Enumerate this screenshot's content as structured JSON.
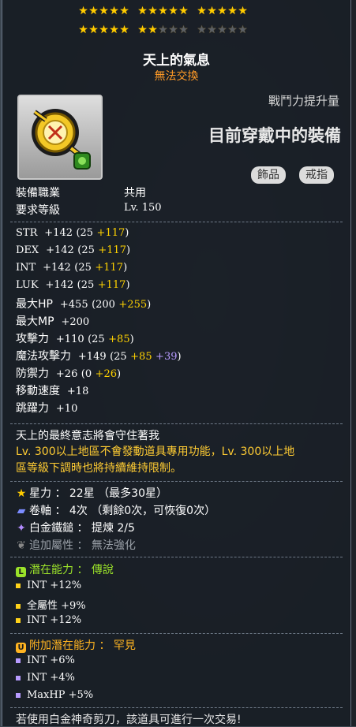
{
  "stars": {
    "row1": [
      1,
      1,
      1,
      1,
      1,
      1,
      1,
      1,
      1,
      1,
      1,
      1,
      1,
      1,
      1
    ],
    "row2_filled": 7,
    "row2_total": 15
  },
  "item": {
    "name": "天上的氣息",
    "trade": "無法交換",
    "power_label": "戰鬥力提升量",
    "equipped_label": "目前穿戴中的裝備",
    "tags": [
      "飾品",
      "戒指"
    ],
    "job_label": "裝備職業",
    "job_value": "共用",
    "level_label": "要求等級",
    "level_value": "Lv. 150"
  },
  "stats": [
    {
      "name": "STR",
      "total": "+142",
      "base": "(25",
      "bonus": "+117",
      "close": ")"
    },
    {
      "name": "DEX",
      "total": "+142",
      "base": "(25",
      "bonus": "+117",
      "close": ")"
    },
    {
      "name": "INT",
      "total": "+142",
      "base": "(25",
      "bonus": "+117",
      "close": ")"
    },
    {
      "name": "LUK",
      "total": "+142",
      "base": "(25",
      "bonus": "+117",
      "close": ")"
    },
    {
      "name": "最大HP",
      "total": "+455",
      "base": "(200",
      "bonus": "+255",
      "close": ")"
    },
    {
      "name": "最大MP",
      "total": "+200"
    },
    {
      "name": "攻擊力",
      "total": "+110",
      "base": "(25",
      "bonus": "+85",
      "close": ")"
    },
    {
      "name": "魔法攻擊力",
      "total": "+149",
      "base": "(25",
      "bonus": "+85",
      "bonus2": "+39",
      "close": ")"
    },
    {
      "name": "防禦力",
      "total": "+26",
      "base": "(0",
      "bonus": "+26",
      "close": ")"
    },
    {
      "name": "移動速度",
      "total": "+18"
    },
    {
      "name": "跳躍力",
      "total": "+10"
    }
  ],
  "description": {
    "line1": "天上的最終意志將會守住著我",
    "line2": "Lv. 300以上地區不會發動道具專用功能，Lv. 300以上地",
    "line3": "區等級下調時也將持續維持限制。"
  },
  "upgrades": {
    "star": "星力 ： 22星 （最多30星）",
    "scroll": "卷軸 ： 4次 （剩餘0次，可恢復0次）",
    "hammer": "白金鐵鎚 ： 提煉 2/5",
    "add": "追加屬性 ： 無法強化"
  },
  "potential": {
    "header": "潛在能力 ： 傳說",
    "rank_icon": "L",
    "color": "#9be22a",
    "lines": [
      "INT +12%",
      "全屬性 +9%",
      "INT +12%"
    ]
  },
  "additional": {
    "header": "附加潛在能力 ： 罕見",
    "rank_icon": "U",
    "color": "#ffb421",
    "lines": [
      "INT +6%",
      "INT +4%",
      "MaxHP +5%"
    ]
  },
  "footer": "若使用白金神奇剪刀，該道具可進行一次交易!"
}
